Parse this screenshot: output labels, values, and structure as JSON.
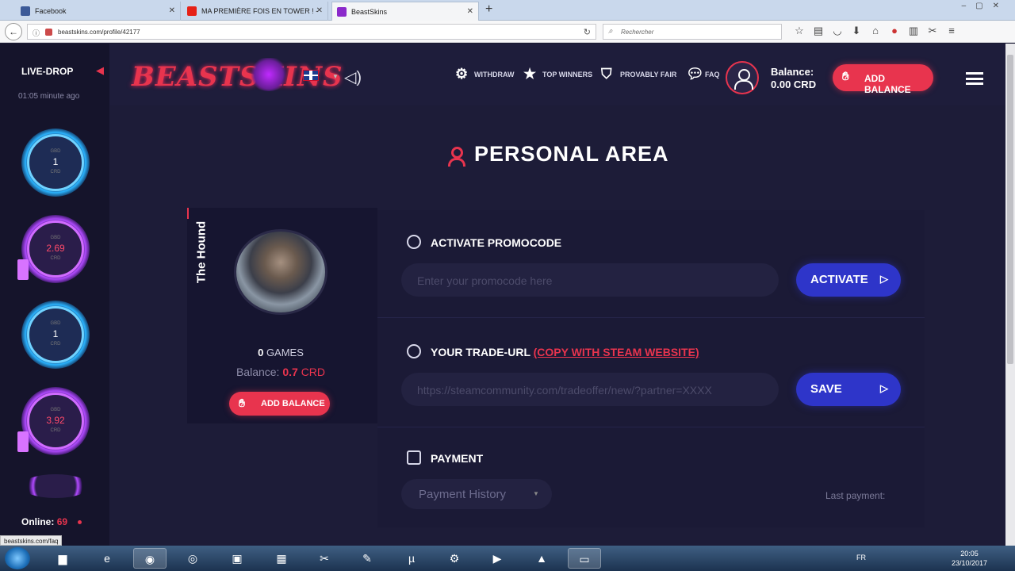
{
  "browser": {
    "tabs": [
      {
        "title": "Facebook",
        "color": "#3b5998"
      },
      {
        "title": "MA PREMIÈRE FOIS EN TOWER ! -",
        "color": "#e62117"
      },
      {
        "title": "BeastSkins",
        "color": "#8b2acb"
      }
    ],
    "url": "beastskins.com/profile/42177",
    "search_placeholder": "Rechercher"
  },
  "sidebar": {
    "title": "LIVE-DROP",
    "time": "01:05 minute ago",
    "drops": [
      {
        "value": "1",
        "style": "blue",
        "label": "GBD",
        "currency": "CRD"
      },
      {
        "value": "2.69",
        "style": "purple",
        "label": "GBD",
        "currency": "CRD"
      },
      {
        "value": "1",
        "style": "blue",
        "label": "GBD",
        "currency": "CRD"
      },
      {
        "value": "3.92",
        "style": "purple",
        "label": "GBD",
        "currency": "CRD"
      }
    ],
    "online_label": "Online:",
    "online_count": "69"
  },
  "status_url": "beastskins.com/faq",
  "header": {
    "logo": "BEASTSKINS",
    "menu": [
      {
        "label": "WITHDRAW",
        "icon": "gear-icon"
      },
      {
        "label": "TOP WINNERS",
        "icon": "star-icon"
      },
      {
        "label": "PROVABLY FAIR",
        "icon": "shield-icon"
      },
      {
        "label": "FAQ",
        "icon": "chat-icon"
      }
    ],
    "balance_label": "Balance:",
    "balance_value": "0.00 CRD",
    "add_balance": "ADD BALANCE"
  },
  "page_title": "PERSONAL AREA",
  "profile": {
    "name": "The Hound",
    "games_count": "0",
    "games_label": "GAMES",
    "balance_label": "Balance:",
    "balance_value": "0.7",
    "balance_unit": "CRD",
    "add_balance": "ADD BALANCE"
  },
  "promocode": {
    "heading": "ACTIVATE PROMOCODE",
    "placeholder": "Enter your promocode here",
    "button": "ACTIVATE"
  },
  "trade": {
    "heading": "YOUR TRADE-URL",
    "link": "(COPY WITH STEAM WEBSITE)",
    "placeholder": "https://steamcommunity.com/tradeoffer/new/?partner=XXXX",
    "button": "SAVE"
  },
  "payment": {
    "heading": "PAYMENT",
    "select": "Payment History",
    "last_label": "Last payment:"
  },
  "taskbar": {
    "lang": "FR",
    "time": "20:05",
    "date": "23/10/2017"
  }
}
